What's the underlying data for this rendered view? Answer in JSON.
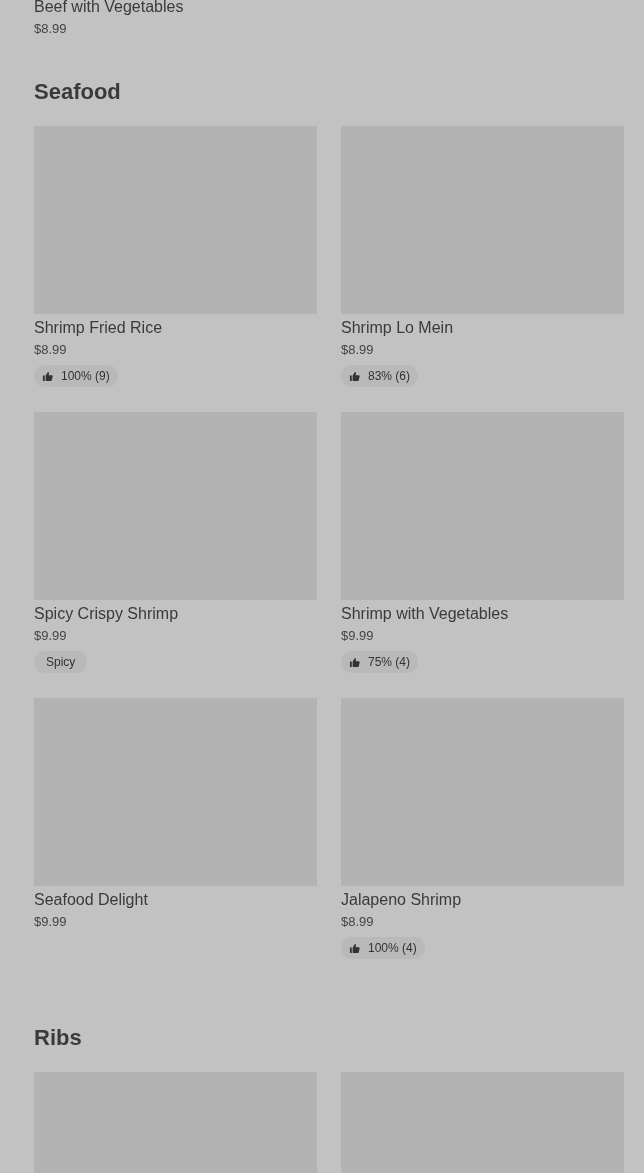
{
  "top_item": {
    "name": "Beef with Vegetables",
    "price": "$8.99"
  },
  "sections": [
    {
      "title": "Seafood",
      "items": [
        {
          "image": true,
          "name": "Shrimp Fried Rice",
          "price": "$8.99",
          "badge": {
            "kind": "rating",
            "text": "100% (9)"
          }
        },
        {
          "image": true,
          "name": "Shrimp Lo Mein",
          "price": "$8.99",
          "badge": {
            "kind": "rating",
            "text": "83% (6)"
          }
        },
        {
          "image": true,
          "name": "Spicy Crispy Shrimp",
          "price": "$9.99",
          "badge": {
            "kind": "tag",
            "text": "Spicy"
          }
        },
        {
          "image": true,
          "name": "Shrimp with Vegetables",
          "price": "$9.99",
          "badge": {
            "kind": "rating",
            "text": "75% (4)"
          }
        },
        {
          "image": true,
          "name": "Seafood Delight",
          "price": "$9.99"
        },
        {
          "image": true,
          "name": "Jalapeno Shrimp",
          "price": "$8.99",
          "badge": {
            "kind": "rating",
            "text": "100% (4)"
          }
        }
      ]
    },
    {
      "title": "Ribs",
      "items": [
        {
          "image": true
        },
        {
          "image": true
        }
      ]
    }
  ]
}
